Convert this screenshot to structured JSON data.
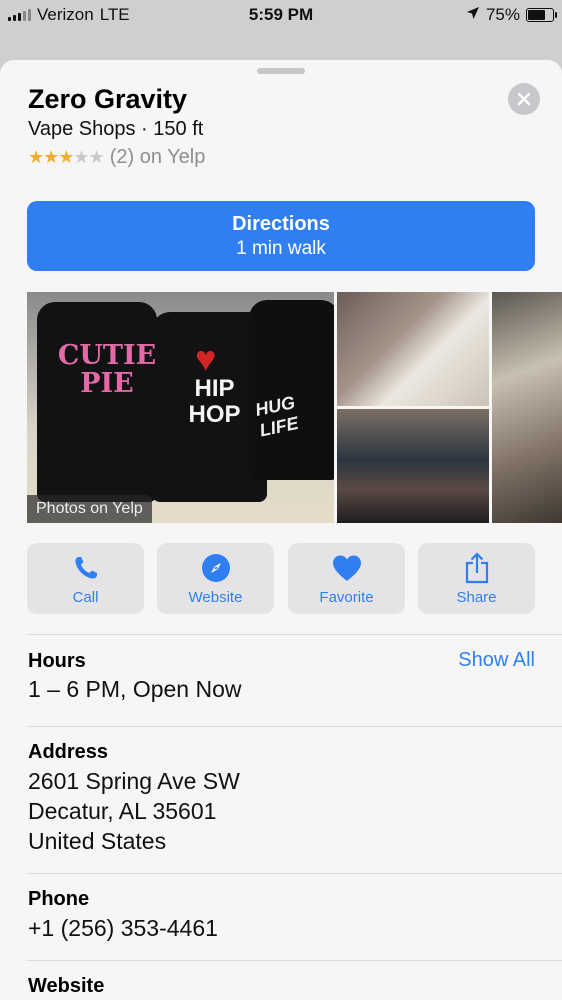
{
  "status_bar": {
    "carrier": "Verizon",
    "network": "LTE",
    "time": "5:59 PM",
    "battery": "75%",
    "battery_level": 0.75
  },
  "place": {
    "name": "Zero Gravity",
    "category_distance": "Vape Shops · 150 ft",
    "rating_stars": 3,
    "rating_max": 5,
    "rating_text": "(2) on Yelp"
  },
  "directions": {
    "label": "Directions",
    "sublabel": "1 min walk"
  },
  "photos": {
    "caption": "Photos on Yelp",
    "main_text_1": "CUTIE PIE",
    "main_text_2": "HIP HOP",
    "main_text_3": "HUG LIFE"
  },
  "actions": [
    {
      "label": "Call",
      "icon": "phone-icon"
    },
    {
      "label": "Website",
      "icon": "compass-icon"
    },
    {
      "label": "Favorite",
      "icon": "heart-icon"
    },
    {
      "label": "Share",
      "icon": "share-icon"
    }
  ],
  "hours": {
    "heading": "Hours",
    "value": "1 – 6 PM, Open Now",
    "show_all": "Show All"
  },
  "address": {
    "heading": "Address",
    "line1": "2601 Spring Ave SW",
    "line2": "Decatur, AL  35601",
    "line3": "United States"
  },
  "phone": {
    "heading": "Phone",
    "value": "+1 (256) 353-4461"
  },
  "website": {
    "heading": "Website"
  },
  "colors": {
    "accent": "#2f7ff2",
    "star": "#f0ad2f"
  }
}
